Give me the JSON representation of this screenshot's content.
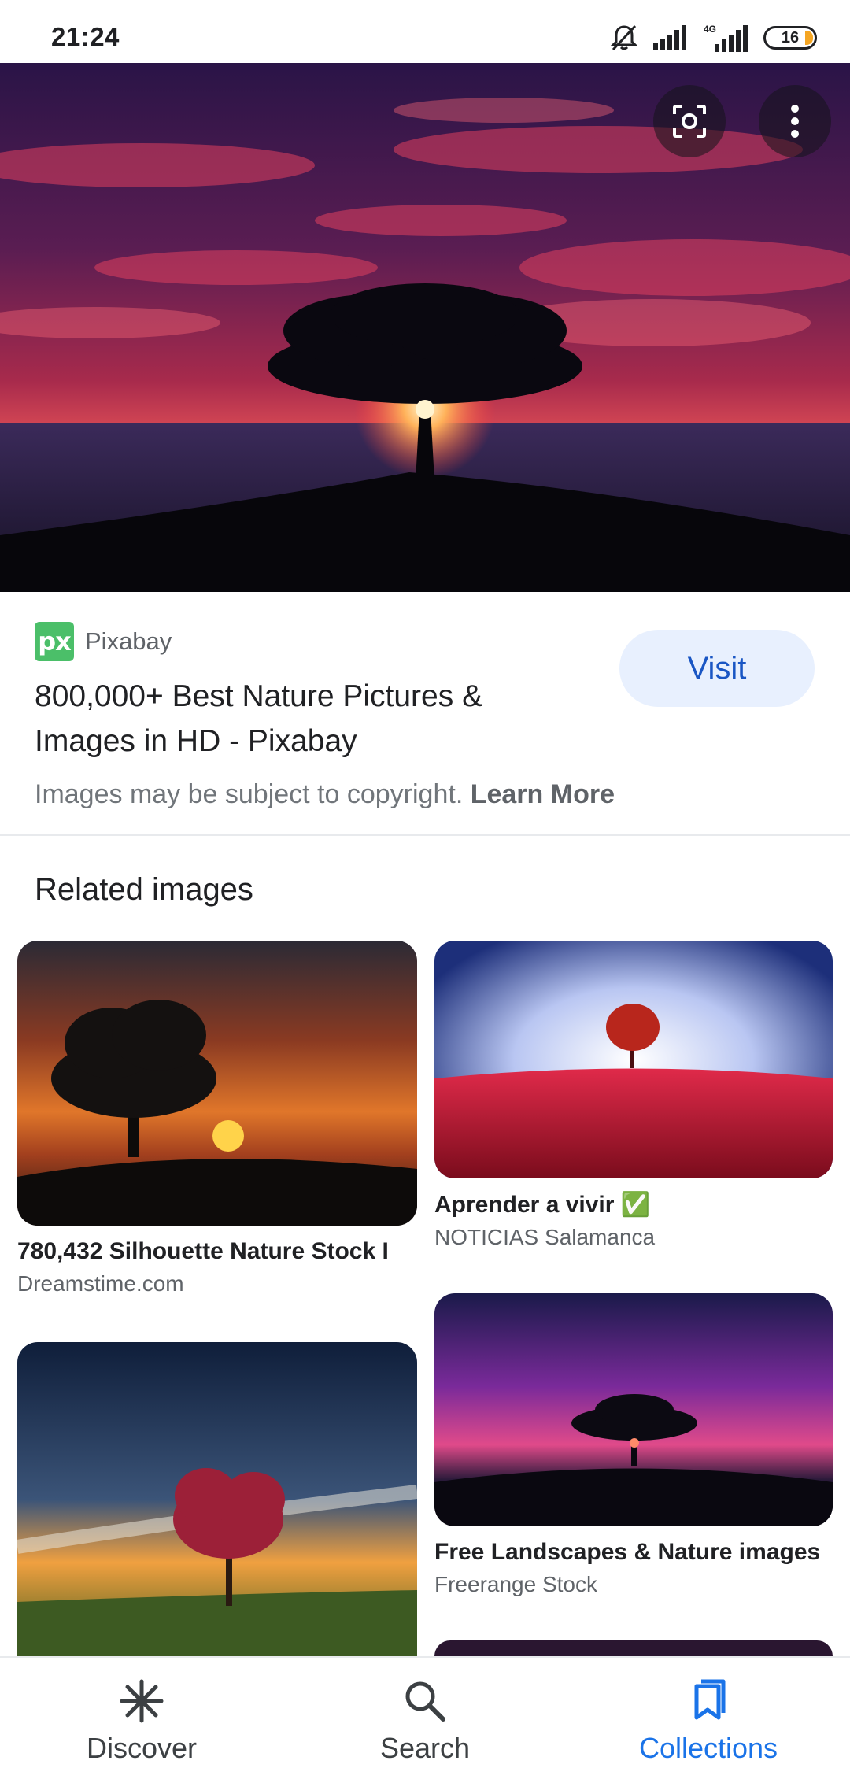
{
  "status_bar": {
    "time": "21:24",
    "battery": "16",
    "network": "4G"
  },
  "hero": {
    "lens_icon": "google-lens-icon",
    "more_icon": "more-vert-icon"
  },
  "result": {
    "source_logo": "px",
    "source_name": "Pixabay",
    "title": "800,000+ Best Nature Pictures & Images in HD - Pixabay",
    "visit_label": "Visit",
    "copyright_text": "Images may be subject to copyright.",
    "learn_more": "Learn More"
  },
  "related": {
    "heading": "Related images",
    "items": [
      {
        "title": "780,432 Silhouette Nature Stock I",
        "source": "Dreamstime.com"
      },
      {
        "title": "Aprender a vivir ✅",
        "source": "NOTICIAS Salamanca"
      },
      {
        "title": "",
        "source": ""
      },
      {
        "title": "Free Landscapes & Nature images",
        "source": "Freerange Stock"
      }
    ]
  },
  "bottom_nav": {
    "items": [
      {
        "label": "Discover",
        "icon": "asterisk-icon"
      },
      {
        "label": "Search",
        "icon": "search-icon"
      },
      {
        "label": "Collections",
        "icon": "bookmarks-icon"
      }
    ],
    "active_color": "#1a73e8"
  }
}
